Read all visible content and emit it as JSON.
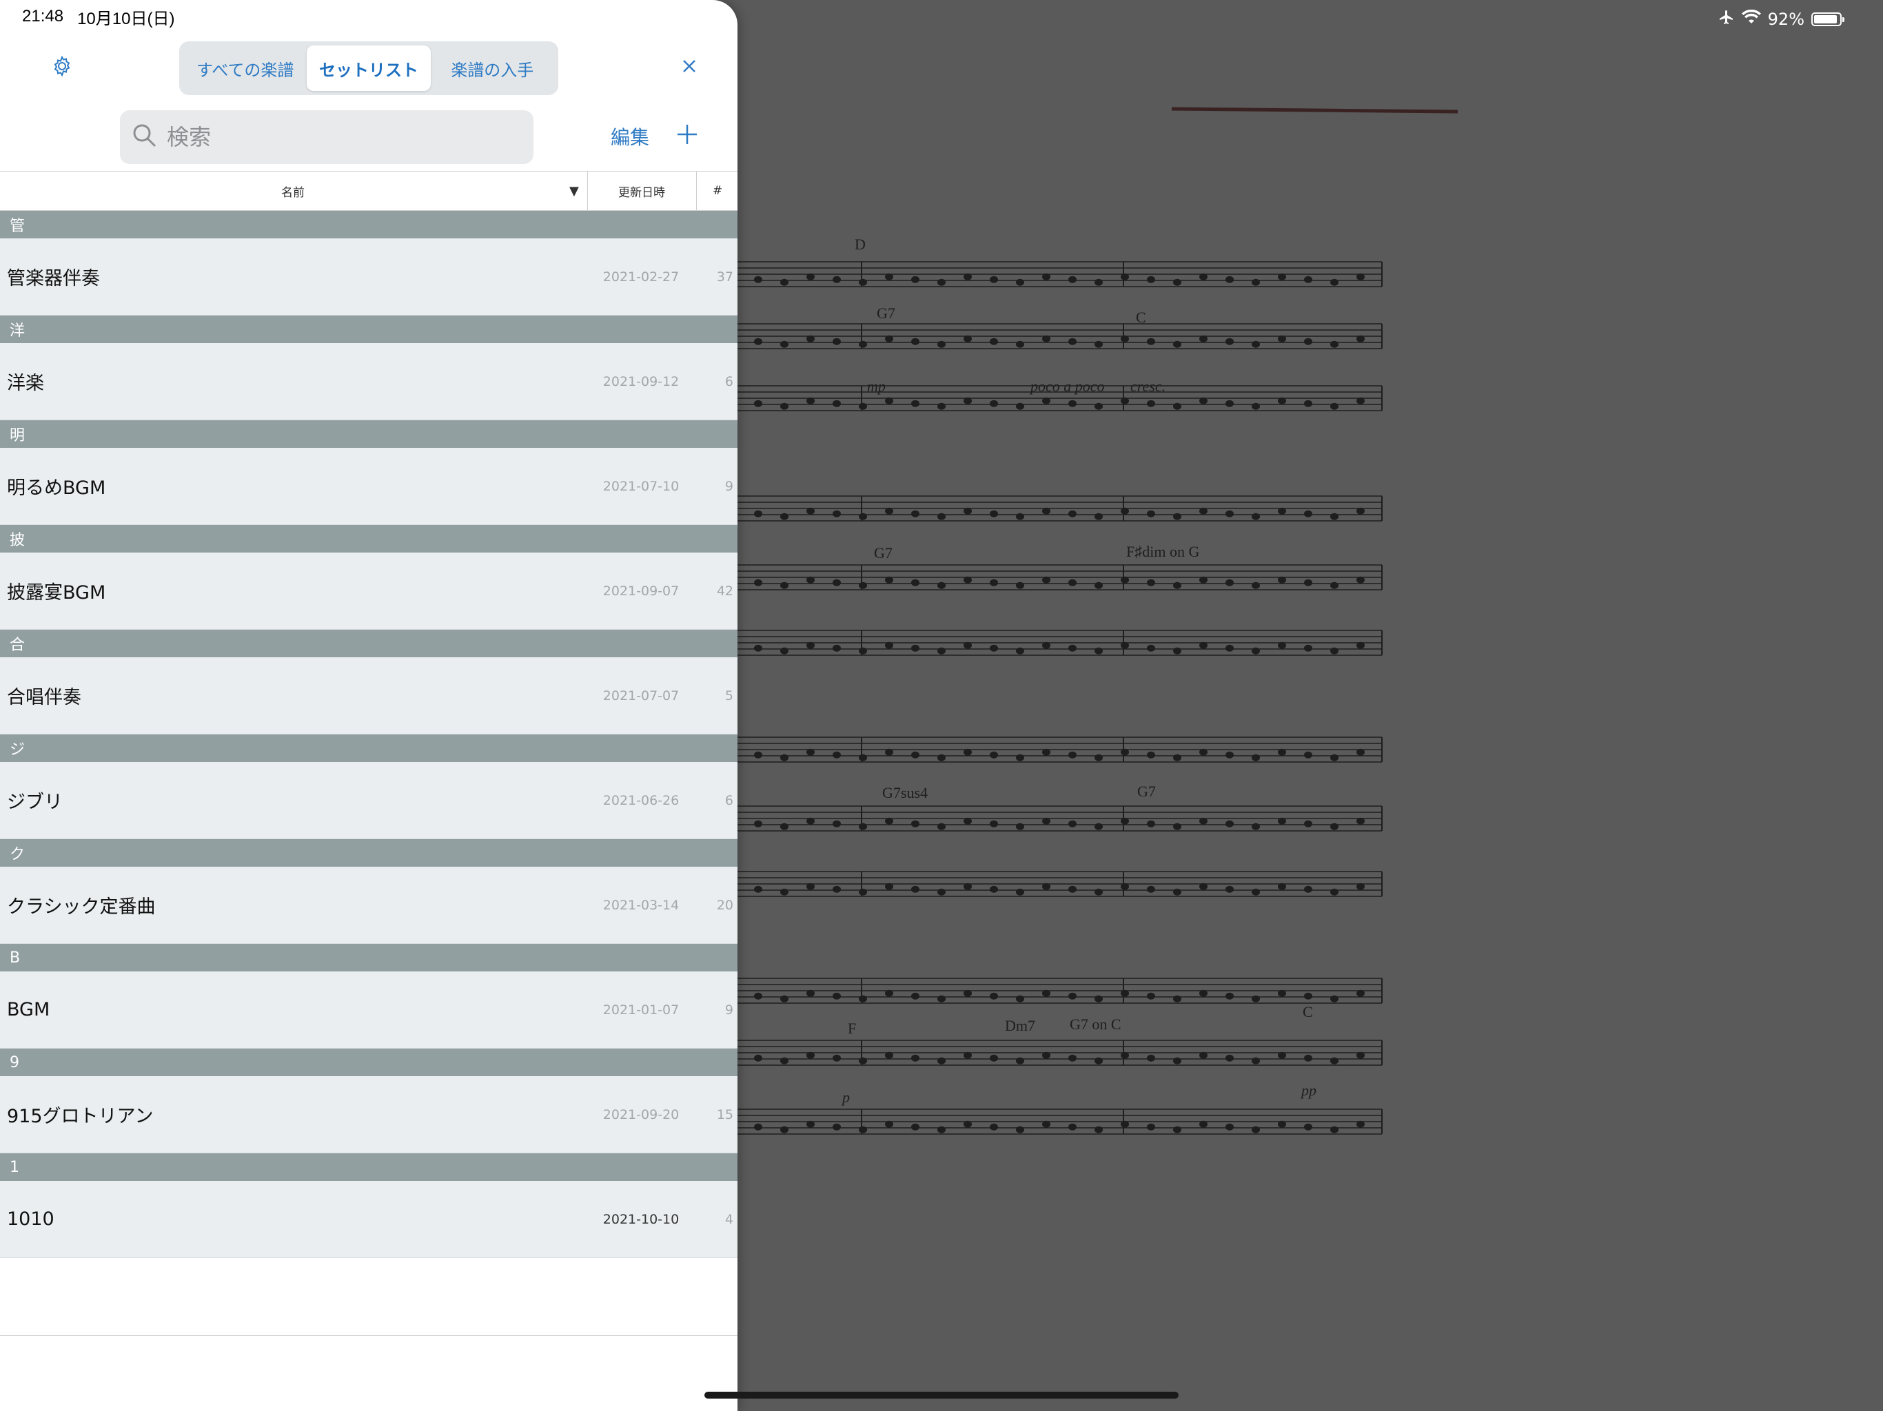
{
  "status_bar": {
    "time": "21:48",
    "date": "10月10日(日)",
    "battery_percent": "92%",
    "battery_level": 0.92,
    "airplane_icon": "airplane-icon",
    "wifi_icon": "wifi-icon"
  },
  "header": {
    "settings_icon": "gear-icon",
    "tabs": [
      {
        "label": "すべての楽譜",
        "active": false
      },
      {
        "label": "セットリスト",
        "active": true
      },
      {
        "label": "楽譜の入手",
        "active": false
      }
    ],
    "close_icon": "close-icon"
  },
  "search": {
    "placeholder": "検索",
    "value": ""
  },
  "toolbar": {
    "edit_label": "編集",
    "add_icon": "plus-icon"
  },
  "columns": {
    "name": "名前",
    "sort_indicator": "▼",
    "updated": "更新日時",
    "count": "#"
  },
  "sections": [
    {
      "header": "管",
      "items": [
        {
          "name": "管楽器伴奏",
          "date": "2021-02-27",
          "count": "37"
        }
      ]
    },
    {
      "header": "洋",
      "items": [
        {
          "name": "洋楽",
          "date": "2021-09-12",
          "count": "6"
        }
      ]
    },
    {
      "header": "明",
      "items": [
        {
          "name": "明るめBGM",
          "date": "2021-07-10",
          "count": "9"
        }
      ]
    },
    {
      "header": "披",
      "items": [
        {
          "name": "披露宴BGM",
          "date": "2021-09-07",
          "count": "42"
        }
      ]
    },
    {
      "header": "合",
      "items": [
        {
          "name": "合唱伴奏",
          "date": "2021-07-07",
          "count": "5"
        }
      ]
    },
    {
      "header": "ジ",
      "items": [
        {
          "name": "ジブリ",
          "date": "2021-06-26",
          "count": "6"
        }
      ]
    },
    {
      "header": "ク",
      "items": [
        {
          "name": "クラシック定番曲",
          "date": "2021-03-14",
          "count": "20"
        }
      ]
    },
    {
      "header": "B",
      "items": [
        {
          "name": "BGM",
          "date": "2021-01-07",
          "count": "9"
        }
      ]
    },
    {
      "header": "9",
      "items": [
        {
          "name": "915グロトリアン",
          "date": "2021-09-20",
          "count": "15"
        }
      ]
    },
    {
      "header": "1",
      "items": [
        {
          "name": "1010",
          "date": "2021-10-10",
          "count": "4"
        }
      ]
    }
  ],
  "score": {
    "rehearsal_mark": "D",
    "chords": [
      "G7",
      "C",
      "G7",
      "F♯dim on G",
      "G7sus4",
      "G7",
      "F",
      "Dm7",
      "G7 on C",
      "C"
    ],
    "dynamics": [
      "mp",
      "poco a poco",
      "cresc.",
      "p",
      "pp"
    ]
  },
  "colors": {
    "accent": "#2f7bc4",
    "section_header": "#929fa1",
    "row_bg": "#eaeef0",
    "overlay": "#5a5a5a"
  }
}
